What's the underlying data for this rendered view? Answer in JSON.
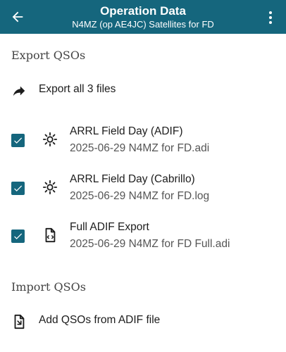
{
  "appbar": {
    "title": "Operation Data",
    "subtitle": "N4MZ (op AE4JC) Satellites for FD"
  },
  "export": {
    "header": "Export QSOs",
    "export_all_label": "Export all 3 files",
    "files": [
      {
        "name": "ARRL Field Day (ADIF)",
        "path": "2025-06-29 N4MZ for FD.adi",
        "checked": true,
        "icon": "field-day-icon"
      },
      {
        "name": "ARRL Field Day (Cabrillo)",
        "path": "2025-06-29 N4MZ for FD.log",
        "checked": true,
        "icon": "field-day-icon"
      },
      {
        "name": "Full ADIF Export",
        "path": "2025-06-29 N4MZ for FD Full.adi",
        "checked": true,
        "icon": "file-code-icon"
      }
    ]
  },
  "import": {
    "header": "Import QSOs",
    "add_label": "Add QSOs from ADIF file"
  },
  "colors": {
    "primary": "#15667d",
    "text": "#1c1c1c",
    "secondary_text": "#555555"
  }
}
